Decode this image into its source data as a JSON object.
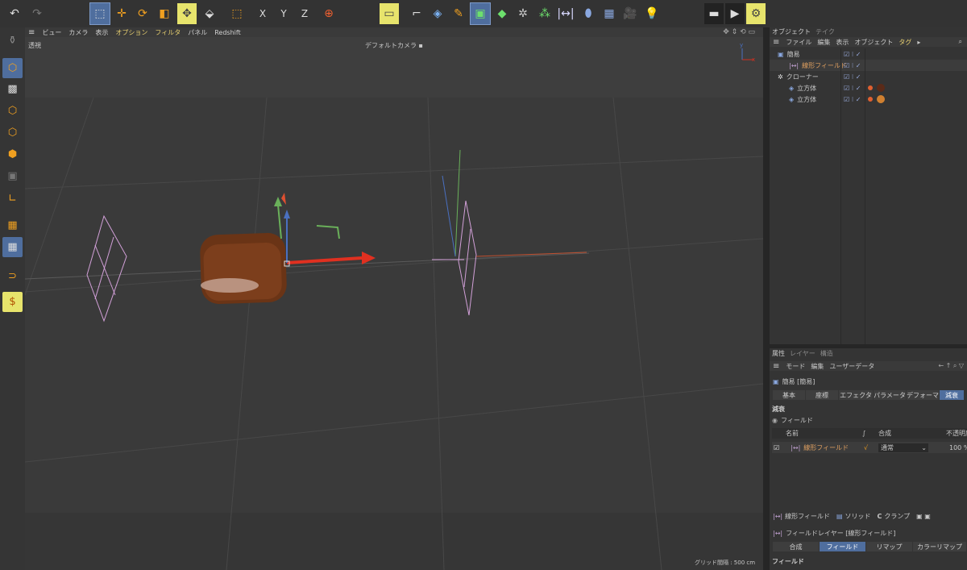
{
  "toolbar": {
    "icons": [
      "undo-icon",
      "redo-icon",
      "live-selection-icon",
      "move-icon",
      "rotate-icon",
      "scale-icon",
      "move-handle-icon",
      "model-icon",
      "lasso-icon",
      "x-axis-icon",
      "y-axis-icon",
      "z-axis-icon",
      "coordinate-icon",
      "view-icon",
      "spline-icon",
      "cube-icon",
      "pen-icon",
      "generator-icon",
      "cube-green-icon",
      "deformer-icon",
      "mograph-icon",
      "field-icon",
      "capsule-icon",
      "floor-icon",
      "camera-icon",
      "light-icon",
      "render-view-icon",
      "render-icon",
      "render-settings-icon"
    ],
    "x_label": "X",
    "y_label": "Y",
    "z_label": "Z"
  },
  "viewport_menu": [
    "ビュー",
    "カメラ",
    "表示",
    "オプション",
    "フィルタ",
    "パネル",
    "Redshift"
  ],
  "viewport": {
    "label": "透視",
    "camera": "デフォルトカメラ",
    "grid_info": "グリッド間隔 : 500 cm"
  },
  "object_manager": {
    "tabs": [
      "オブジェクト",
      "テイク"
    ],
    "menu": [
      "ファイル",
      "編集",
      "表示",
      "オブジェクト",
      "タグ"
    ],
    "objects": [
      {
        "name": "簡易",
        "indent": 0,
        "color": "#d9d9d9"
      },
      {
        "name": "線形フィールド",
        "indent": 1,
        "color": "#e0a060"
      },
      {
        "name": "クローナー",
        "indent": 0,
        "color": "#d9d9d9"
      },
      {
        "name": "立方体",
        "indent": 1,
        "color": "#d9d9d9"
      },
      {
        "name": "立方体",
        "indent": 1,
        "color": "#d9d9d9"
      }
    ]
  },
  "attributes": {
    "tabs": [
      "属性",
      "レイヤー",
      "構造"
    ],
    "menu": [
      "モード",
      "編集",
      "ユーザーデータ"
    ],
    "object_title": "簡易 [簡易]",
    "subtabs": [
      "基本",
      "座標",
      "エフェクタ",
      "パラメータ",
      "デフォーマ",
      "減衰"
    ],
    "section": "減衰",
    "field_label": "フィールド",
    "columns": [
      "名前",
      "合成",
      "不透明度"
    ],
    "field_row": {
      "name": "線形フィールド",
      "blend": "通常",
      "opacity": "100 %"
    },
    "add_buttons": [
      "線形フィールド",
      "ソリッド",
      "クランプ"
    ],
    "layer_title": "フィールドレイヤー [線形フィールド]",
    "layer_tabs": [
      "合成",
      "フィールド",
      "リマップ",
      "カラーリマップ"
    ],
    "layer_section": "フィールド"
  }
}
